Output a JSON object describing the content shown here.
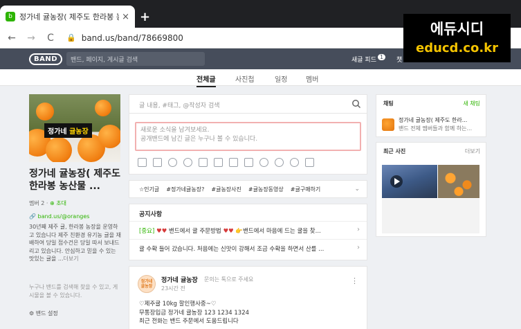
{
  "browser": {
    "tab_title": "정가네 귤농장( 제주도 한라봉 농",
    "tab_close": "×",
    "new_tab": "+",
    "back": "←",
    "forward": "→",
    "reload": "C",
    "url": "band.us/band/78669800"
  },
  "watermark": {
    "line1": "에듀시디",
    "line2": "educd.co.kr"
  },
  "header": {
    "logo": "BAND",
    "search_placeholder": "밴드, 페이지, 게시글 검색",
    "feed_label": "새글 피드",
    "feed_count": "1",
    "chat_label": "챗"
  },
  "subnav": {
    "items": [
      "전체글",
      "사진첩",
      "일정",
      "멤버"
    ]
  },
  "left": {
    "cover_label_a": "정가네 ",
    "cover_label_b": "귤농장",
    "band_name": "정가네 귤농장( 제주도 한라봉 농산물 ...",
    "members": "멤버 2 · ",
    "invite": "⊕ 초대",
    "band_url": "🔗 band.us/@oranges",
    "description": "30년째 제주 귤, 한라봉 농장을 운영하고 있습니다 제주 친환경 유기농 귤을 재배하여 당일 접수건은 당일 따서 보내드리고 있습니다. 안심하고 믿을 수 있는 맛있는 귤을 ...",
    "more": "더보기",
    "hint": "누구나 밴드를 검색해 찾을 수 있고, 게시물을 볼 수 있습니다.",
    "settings": "⚙ 밴드 설정"
  },
  "center": {
    "post_search_placeholder": "글 내용, #태그, @작성자 검색",
    "write_placeholder_1": "새로운 소식을 남겨보세요.",
    "write_placeholder_2": "공개밴드에 남긴 글은 누구나 볼 수 있습니다.",
    "tags": [
      "☆인기글",
      "#정가네귤농장?",
      "#귤농장사진",
      "#귤농장동영상",
      "#귤구매하기"
    ],
    "notice_title": "공지사항",
    "notice_1_badge": "[중요]",
    "notice_1_text": " 밴드에서 귤 주문방법 ",
    "notice_1_text2": "👉밴드에서 마음에 드는 귤을 찾...",
    "notice_2_text": "귤 수확 들어 갔습니다. 처음에는 신맛이 강해서 조금 수확을 하면서 산를 ...",
    "post_author": "정가네 귤농장",
    "post_role": "문의는 톡으로 주세요",
    "post_time": "23시간 전",
    "post_avatar": "정가네 귤농장",
    "post_body_1": "♡제주귤 10kg 할인행사중~♡",
    "post_body_2": "무통장입금 정가네 귤농장 123 1234 1324",
    "post_body_3": "최근 전화는 밴드 주문에서 도움드립니다"
  },
  "right": {
    "chat_title": "채팅",
    "chat_new": "새 채팅",
    "chat_room": "정가네 귤농장( 제주도 한라...",
    "chat_sub": "밴드 전체 멤버들과 함께 하는...",
    "photos_title": "최근 사진",
    "photos_more": "더보기"
  }
}
